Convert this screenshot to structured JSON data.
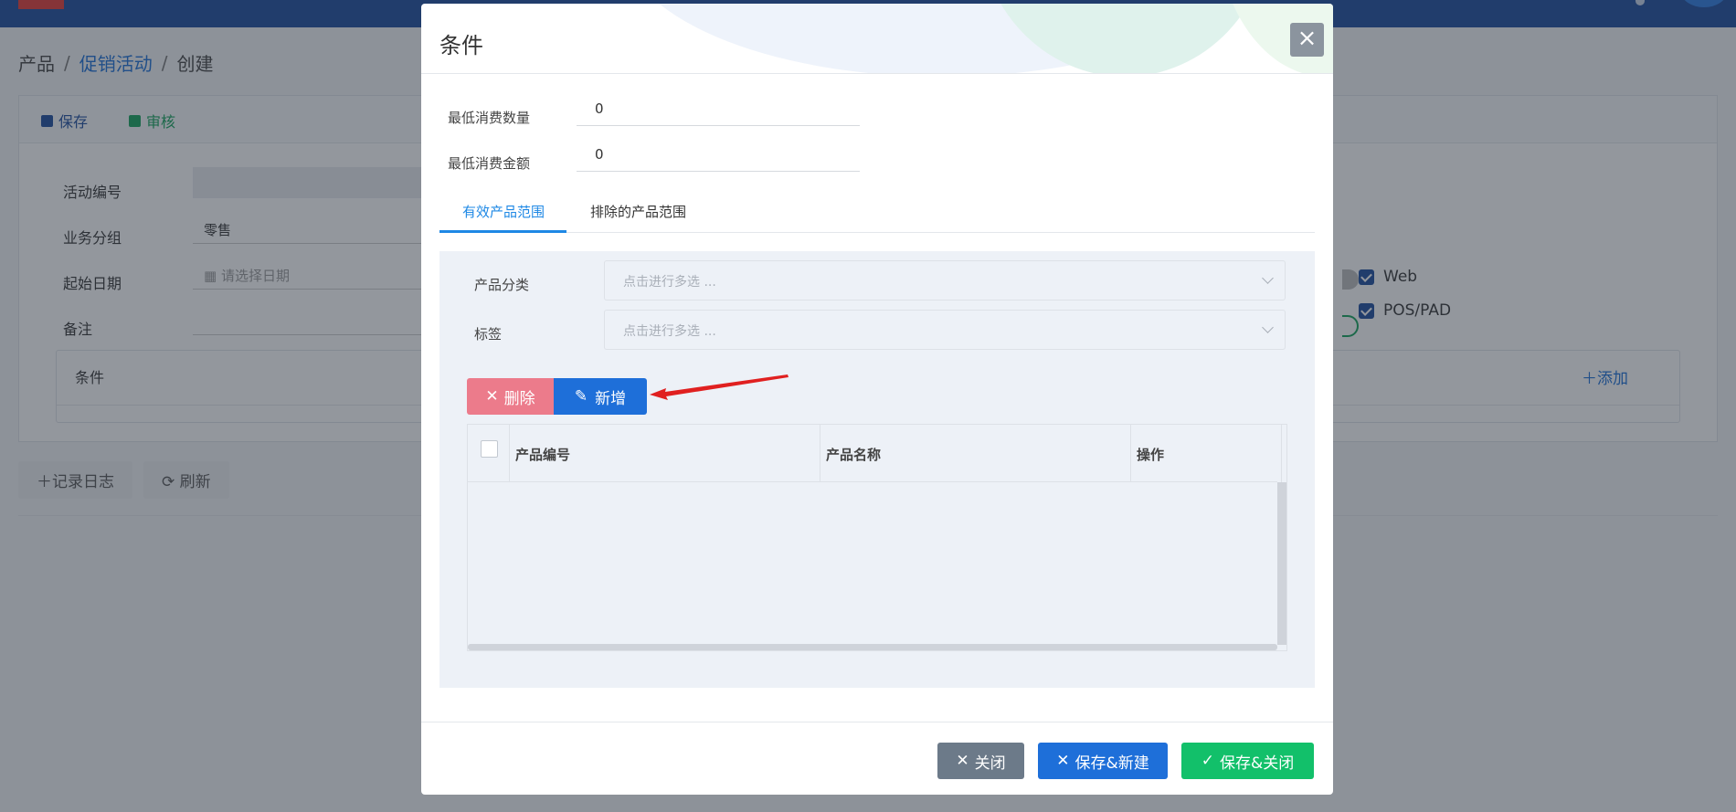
{
  "breadcrumb": {
    "root": "产品",
    "section": "促销活动",
    "current": "创建",
    "separator": "/"
  },
  "toolbar": {
    "save_label": "保存",
    "audit_label": "审核"
  },
  "form": {
    "activity_no_label": "活动编号",
    "biz_group_label": "业务分组",
    "biz_group_value": "零售",
    "start_date_label": "起始日期",
    "start_date_placeholder": "请选择日期",
    "remark_label": "备注"
  },
  "channels": [
    "Web",
    "POS/PAD"
  ],
  "conditions": {
    "title": "条件",
    "add_label": "添加"
  },
  "bottom_actions": {
    "log_label": "记录日志",
    "refresh_label": "刷新"
  },
  "modal": {
    "title": "条件",
    "close_icon": "×",
    "min_qty_label": "最低消费数量",
    "min_qty_value": "0",
    "min_amount_label": "最低消费金额",
    "min_amount_value": "0",
    "tabs": [
      "有效产品范围",
      "排除的产品范围"
    ],
    "category_label": "产品分类",
    "category_placeholder": "点击进行多选 ...",
    "tag_label": "标签",
    "tag_placeholder": "点击进行多选 ...",
    "delete_label": "删除",
    "add_label": "新增",
    "columns": [
      "产品编号",
      "产品名称",
      "操作"
    ],
    "footer": {
      "close_label": "关闭",
      "save_new_label": "保存&新建",
      "save_close_label": "保存&关闭"
    }
  },
  "colors": {
    "primary": "#1e6fd9",
    "danger": "#ec7b8b",
    "success": "#12c06a",
    "neutral": "#6c7a89",
    "annotation": "#e02020"
  }
}
